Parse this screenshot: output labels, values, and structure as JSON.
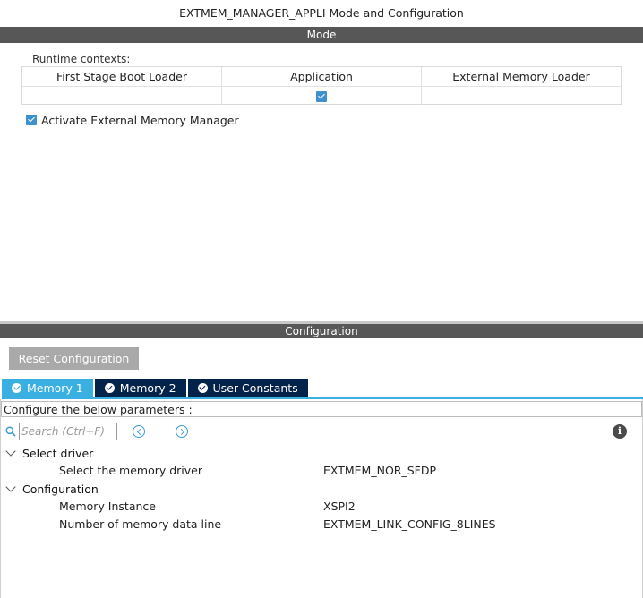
{
  "window": {
    "title": "EXTMEM_MANAGER_APPLI Mode and Configuration"
  },
  "mode": {
    "section_title": "Mode",
    "runtime_label": "Runtime contexts:",
    "columns": [
      {
        "label": "First Stage Boot Loader",
        "checked": false
      },
      {
        "label": "Application",
        "checked": true
      },
      {
        "label": "External Memory Loader",
        "checked": false
      }
    ],
    "activate": {
      "label": "Activate External Memory Manager",
      "checked": true
    }
  },
  "configuration": {
    "section_title": "Configuration",
    "reset_label": "Reset Configuration",
    "tabs": [
      {
        "label": "Memory 1",
        "active": true
      },
      {
        "label": "Memory 2",
        "active": false
      },
      {
        "label": "User Constants",
        "active": false
      }
    ],
    "instructions": "Configure the below parameters :",
    "search": {
      "placeholder": "Search (Ctrl+F)",
      "value": ""
    },
    "groups": [
      {
        "title": "Select driver",
        "params": [
          {
            "name": "Select the memory driver",
            "value": "EXTMEM_NOR_SFDP"
          }
        ]
      },
      {
        "title": "Configuration",
        "params": [
          {
            "name": "Memory Instance",
            "value": "XSPI2"
          },
          {
            "name": "Number of memory data line",
            "value": "EXTMEM_LINK_CONFIG_8LINES"
          }
        ]
      }
    ]
  },
  "colors": {
    "section_bar": "#575757",
    "tab_active": "#3ab0e2",
    "tab_inactive": "#03234b",
    "checkbox": "#3d92cc"
  },
  "icons": [
    "check-icon",
    "search-icon",
    "chevron-left-icon",
    "chevron-right-icon",
    "info-icon",
    "chevron-down-icon"
  ]
}
